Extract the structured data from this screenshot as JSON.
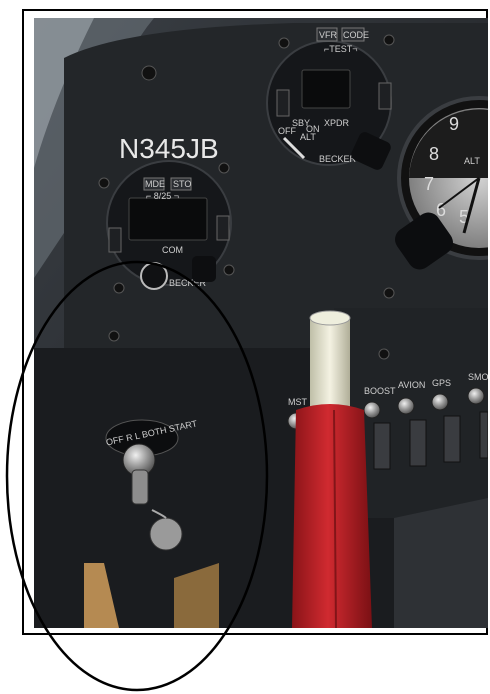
{
  "panel": {
    "tail_number": "N345JB",
    "transponder": {
      "title": "XPDR",
      "buttons": [
        "VFR",
        "CODE"
      ],
      "test_label": "⌐TEST¬",
      "mode_labels": [
        "OFF",
        "SBY",
        "ON",
        "ALT"
      ],
      "brand": "BECKER"
    },
    "com": {
      "title": "COM",
      "buttons": [
        "MDE",
        "STO"
      ],
      "spacing_label": "⌐ 8/25 ¬",
      "brand": "BECKER"
    },
    "switches": [
      "MST",
      "BOOST",
      "AVION",
      "GPS",
      "SMO"
    ],
    "ignition_label": "OFF  R  L  BOTH START",
    "altimeter_digits": [
      "9",
      "8",
      "7",
      "6",
      "5"
    ],
    "altimeter_label": "ALT"
  },
  "annotation": {
    "color": "#000000"
  }
}
